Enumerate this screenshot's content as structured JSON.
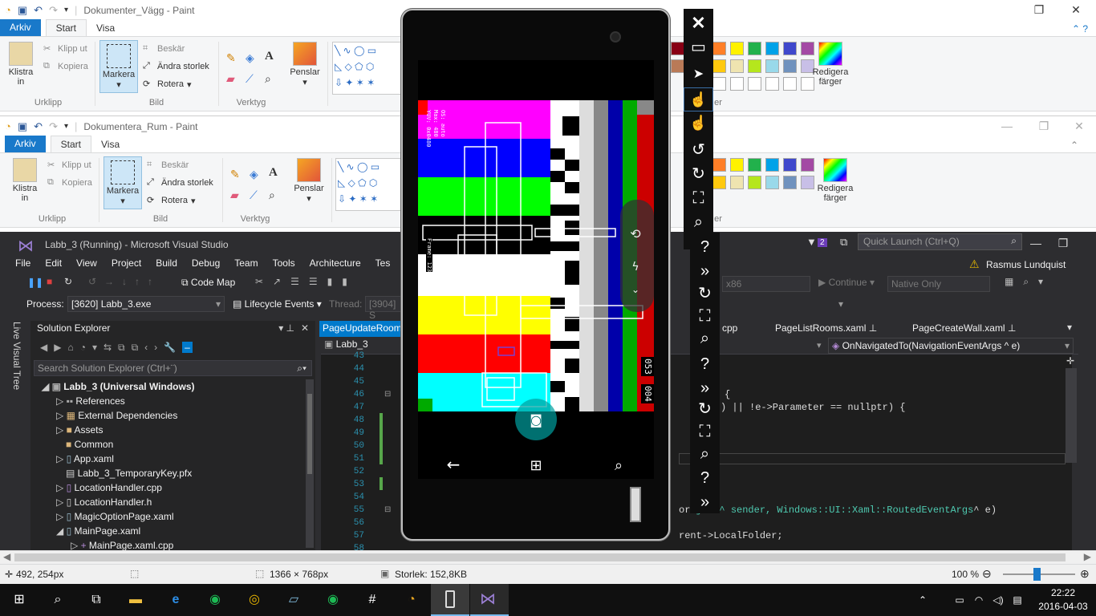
{
  "paint1": {
    "title": "Dokumenter_Vägg - Paint",
    "tabs": [
      "Arkiv",
      "Start",
      "Visa"
    ],
    "clipboard": {
      "paste": "Klistra",
      "paste2": "in",
      "cut": "Klipp ut",
      "copy": "Kopiera",
      "group": "Urklipp"
    },
    "image": {
      "select": "Markera",
      "crop": "Beskär",
      "resize": "Ändra storlek",
      "rotate": "Rotera",
      "group": "Bild"
    },
    "tools": {
      "group": "Verktyg"
    },
    "brushes": "Penslar",
    "edit_colors": "Redigera",
    "edit_colors2": "färger",
    "colors_group": "er"
  },
  "paint2": {
    "title": "Dokumentera_Rum - Paint",
    "tabs": [
      "Arkiv",
      "Start",
      "Visa"
    ],
    "clipboard": {
      "paste": "Klistra",
      "paste2": "in",
      "cut": "Klipp ut",
      "copy": "Kopiera",
      "group": "Urklipp"
    },
    "image": {
      "select": "Markera",
      "crop": "Beskär",
      "resize": "Ändra storlek",
      "rotate": "Rotera",
      "group": "Bild"
    },
    "tools": {
      "group": "Verktyg"
    },
    "brushes": "Penslar",
    "edit_colors": "Redigera",
    "edit_colors2": "färger",
    "colors_group": "er"
  },
  "vs": {
    "title": "Labb_3 (Running) - Microsoft Visual Studio",
    "notif_count": "2",
    "quick_launch": "Quick Launch (Ctrl+Q)",
    "user": "Rasmus Lundquist",
    "menu": [
      "File",
      "Edit",
      "View",
      "Project",
      "Build",
      "Debug",
      "Team",
      "Tools",
      "Architecture",
      "Tes"
    ],
    "codemap": "Code Map",
    "platform": "x86",
    "continue": "Continue",
    "native": "Native Only",
    "process_label": "Process:",
    "process_value": "[3620] Labb_3.exe",
    "lifecycle": "Lifecycle Events",
    "thread_label": "Thread:",
    "thread_value": "[3904] S",
    "live_visual_tree": "Live Visual Tree",
    "solution_explorer": "Solution Explorer",
    "search_placeholder": "Search Solution Explorer (Ctrl+¨)",
    "tree": [
      {
        "label": "Labb_3 (Universal Windows)",
        "bold": true
      },
      {
        "label": "References"
      },
      {
        "label": "External Dependencies"
      },
      {
        "label": "Assets"
      },
      {
        "label": "Common"
      },
      {
        "label": "App.xaml"
      },
      {
        "label": "Labb_3_TemporaryKey.pfx"
      },
      {
        "label": "LocationHandler.cpp"
      },
      {
        "label": "LocationHandler.h"
      },
      {
        "label": "MagicOptionPage.xaml"
      },
      {
        "label": "MainPage.xaml"
      },
      {
        "label": "MainPage.xaml.cpp"
      }
    ],
    "doc_tabs": {
      "active": "PageUpdateRoom",
      "t2": "cpp",
      "t3": "PageListRooms.xaml",
      "t4": "PageCreateWall.xaml"
    },
    "nav_project": "Labb_3",
    "nav_member": "OnNavigatedTo(NavigationEventArgs ^ e)",
    "line_numbers": [
      "43",
      "44",
      "45",
      "46",
      "47",
      "48",
      "49",
      "50",
      "51",
      "52",
      "53",
      "54",
      "55",
      "56",
      "57",
      "58"
    ],
    "code": {
      "l47": ") || !e->Parameter == nullptr) {",
      "l46": "{",
      "l55a": "ject^ sender, Windows::UI::Xaml::",
      "l55b": "RoutedEventArgs",
      "l55c": "^ e)",
      "l55pre": "or",
      "l57": "rent->LocalFolder;"
    }
  },
  "status": {
    "coords": "492, 254px",
    "dims": "1366 × 768px",
    "size": "Storlek: 152,8KB",
    "zoom": "100 %"
  },
  "taskbar": {
    "time": "22:22",
    "date": "2016-04-03"
  },
  "phone": {
    "overlay_lines": [
      "OS: auto",
      "Max: 480",
      "YUV: 0x0480"
    ],
    "frame_label": "Frame: 123",
    "right_vals": [
      "053",
      "004"
    ]
  }
}
